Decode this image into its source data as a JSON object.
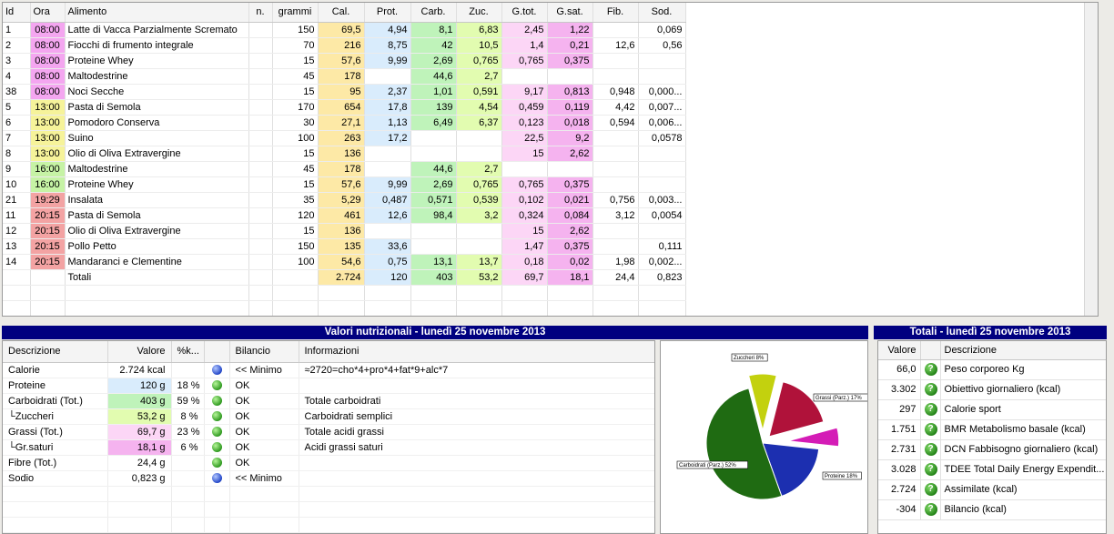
{
  "colors": {
    "ora_morning": "#f4a6f0",
    "ora_midday": "#f6f39a",
    "ora_snack": "#c6f3a5",
    "ora_evening": "#f3a3a3",
    "cal": "#fde9a6",
    "prot": "#d9ecfc",
    "carb": "#bff3ba",
    "zuc": "#e2fcb0",
    "gtot": "#fcd6f6",
    "gsat": "#f5b3ef",
    "title_bar": "#000080"
  },
  "food_table": {
    "headers": [
      "Id",
      "Ora",
      "Alimento",
      "n.",
      "grammi",
      "Cal.",
      "Prot.",
      "Carb.",
      "Zuc.",
      "G.tot.",
      "G.sat.",
      "Fib.",
      "Sod."
    ],
    "rows": [
      {
        "id": "1",
        "ora": "08:00",
        "oraclass": "morning",
        "alimento": "Latte di Vacca Parzialmente Scremato",
        "n": "",
        "grammi": "150",
        "cal": "69,5",
        "prot": "4,94",
        "carb": "8,1",
        "zuc": "6,83",
        "gtot": "2,45",
        "gsat": "1,22",
        "fib": "",
        "sod": "0,069"
      },
      {
        "id": "2",
        "ora": "08:00",
        "oraclass": "morning",
        "alimento": "Fiocchi di frumento integrale",
        "n": "",
        "grammi": "70",
        "cal": "216",
        "prot": "8,75",
        "carb": "42",
        "zuc": "10,5",
        "gtot": "1,4",
        "gsat": "0,21",
        "fib": "12,6",
        "sod": "0,56"
      },
      {
        "id": "3",
        "ora": "08:00",
        "oraclass": "morning",
        "alimento": "Proteine Whey",
        "n": "",
        "grammi": "15",
        "cal": "57,6",
        "prot": "9,99",
        "carb": "2,69",
        "zuc": "0,765",
        "gtot": "0,765",
        "gsat": "0,375",
        "fib": "",
        "sod": ""
      },
      {
        "id": "4",
        "ora": "08:00",
        "oraclass": "morning",
        "alimento": "Maltodestrine",
        "n": "",
        "grammi": "45",
        "cal": "178",
        "prot": "",
        "carb": "44,6",
        "zuc": "2,7",
        "gtot": "",
        "gsat": "",
        "fib": "",
        "sod": ""
      },
      {
        "id": "38",
        "ora": "08:00",
        "oraclass": "morning",
        "alimento": "Noci Secche",
        "n": "",
        "grammi": "15",
        "cal": "95",
        "prot": "2,37",
        "carb": "1,01",
        "zuc": "0,591",
        "gtot": "9,17",
        "gsat": "0,813",
        "fib": "0,948",
        "sod": "0,000..."
      },
      {
        "id": "5",
        "ora": "13:00",
        "oraclass": "midday",
        "alimento": "Pasta di Semola",
        "n": "",
        "grammi": "170",
        "cal": "654",
        "prot": "17,8",
        "carb": "139",
        "zuc": "4,54",
        "gtot": "0,459",
        "gsat": "0,119",
        "fib": "4,42",
        "sod": "0,007..."
      },
      {
        "id": "6",
        "ora": "13:00",
        "oraclass": "midday",
        "alimento": "Pomodoro Conserva",
        "n": "",
        "grammi": "30",
        "cal": "27,1",
        "prot": "1,13",
        "carb": "6,49",
        "zuc": "6,37",
        "gtot": "0,123",
        "gsat": "0,018",
        "fib": "0,594",
        "sod": "0,006..."
      },
      {
        "id": "7",
        "ora": "13:00",
        "oraclass": "midday",
        "alimento": "Suino",
        "n": "",
        "grammi": "100",
        "cal": "263",
        "prot": "17,2",
        "carb": "",
        "zuc": "",
        "gtot": "22,5",
        "gsat": "9,2",
        "fib": "",
        "sod": "0,0578"
      },
      {
        "id": "8",
        "ora": "13:00",
        "oraclass": "midday",
        "alimento": "Olio di Oliva Extravergine",
        "n": "",
        "grammi": "15",
        "cal": "136",
        "prot": "",
        "carb": "",
        "zuc": "",
        "gtot": "15",
        "gsat": "2,62",
        "fib": "",
        "sod": ""
      },
      {
        "id": "9",
        "ora": "16:00",
        "oraclass": "snack",
        "alimento": "Maltodestrine",
        "n": "",
        "grammi": "45",
        "cal": "178",
        "prot": "",
        "carb": "44,6",
        "zuc": "2,7",
        "gtot": "",
        "gsat": "",
        "fib": "",
        "sod": ""
      },
      {
        "id": "10",
        "ora": "16:00",
        "oraclass": "snack",
        "alimento": "Proteine Whey",
        "n": "",
        "grammi": "15",
        "cal": "57,6",
        "prot": "9,99",
        "carb": "2,69",
        "zuc": "0,765",
        "gtot": "0,765",
        "gsat": "0,375",
        "fib": "",
        "sod": ""
      },
      {
        "id": "21",
        "ora": "19:29",
        "oraclass": "evening",
        "alimento": "Insalata",
        "n": "",
        "grammi": "35",
        "cal": "5,29",
        "prot": "0,487",
        "carb": "0,571",
        "zuc": "0,539",
        "gtot": "0,102",
        "gsat": "0,021",
        "fib": "0,756",
        "sod": "0,003..."
      },
      {
        "id": "11",
        "ora": "20:15",
        "oraclass": "evening",
        "alimento": "Pasta di Semola",
        "n": "",
        "grammi": "120",
        "cal": "461",
        "prot": "12,6",
        "carb": "98,4",
        "zuc": "3,2",
        "gtot": "0,324",
        "gsat": "0,084",
        "fib": "3,12",
        "sod": "0,0054"
      },
      {
        "id": "12",
        "ora": "20:15",
        "oraclass": "evening",
        "alimento": "Olio di Oliva Extravergine",
        "n": "",
        "grammi": "15",
        "cal": "136",
        "prot": "",
        "carb": "",
        "zuc": "",
        "gtot": "15",
        "gsat": "2,62",
        "fib": "",
        "sod": ""
      },
      {
        "id": "13",
        "ora": "20:15",
        "oraclass": "evening",
        "alimento": "Pollo Petto",
        "n": "",
        "grammi": "150",
        "cal": "135",
        "prot": "33,6",
        "carb": "",
        "zuc": "",
        "gtot": "1,47",
        "gsat": "0,375",
        "fib": "",
        "sod": "0,111"
      },
      {
        "id": "14",
        "ora": "20:15",
        "oraclass": "evening",
        "alimento": "Mandaranci e Clementine",
        "n": "",
        "grammi": "100",
        "cal": "54,6",
        "prot": "0,75",
        "carb": "13,1",
        "zuc": "13,7",
        "gtot": "0,18",
        "gsat": "0,02",
        "fib": "1,98",
        "sod": "0,002..."
      }
    ],
    "totals": {
      "label": "Totali",
      "cal": "2.724",
      "prot": "120",
      "carb": "403",
      "zuc": "53,2",
      "gtot": "69,7",
      "gsat": "18,1",
      "fib": "24,4",
      "sod": "0,823"
    }
  },
  "nutri_panel": {
    "title": "Valori nutrizionali - lunedì 25 novembre 2013",
    "headers": [
      "Descrizione",
      "Valore",
      "%k...",
      "",
      "Bilancio",
      "Informazioni"
    ],
    "rows": [
      {
        "desc": "Calorie",
        "valore": "2.724 kcal",
        "pct": "",
        "status": "blue",
        "bilancio": "<< Minimo",
        "info": "≈2720=cho*4+pro*4+fat*9+alc*7",
        "bg": ""
      },
      {
        "desc": "Proteine",
        "valore": "120 g",
        "pct": "18 %",
        "status": "green",
        "bilancio": "OK",
        "info": "",
        "bg": "#d9ecfc"
      },
      {
        "desc": "Carboidrati (Tot.)",
        "valore": "403 g",
        "pct": "59 %",
        "status": "green",
        "bilancio": "OK",
        "info": "Totale carboidrati",
        "bg": "#bff3ba"
      },
      {
        "desc": "└Zuccheri",
        "valore": "53,2 g",
        "pct": "8 %",
        "status": "green",
        "bilancio": "OK",
        "info": "Carboidrati semplici",
        "bg": "#e2fcb0"
      },
      {
        "desc": "Grassi (Tot.)",
        "valore": "69,7 g",
        "pct": "23 %",
        "status": "green",
        "bilancio": "OK",
        "info": "Totale acidi grassi",
        "bg": "#fcd6f6"
      },
      {
        "desc": "└Gr.saturi",
        "valore": "18,1 g",
        "pct": "6 %",
        "status": "green",
        "bilancio": "OK",
        "info": "Acidi grassi saturi",
        "bg": "#f5b3ef"
      },
      {
        "desc": "Fibre (Tot.)",
        "valore": "24,4 g",
        "pct": "",
        "status": "green",
        "bilancio": "OK",
        "info": "",
        "bg": ""
      },
      {
        "desc": "Sodio",
        "valore": "0,823 g",
        "pct": "",
        "status": "blue",
        "bilancio": "<< Minimo",
        "info": "",
        "bg": ""
      }
    ]
  },
  "chart_data": {
    "type": "pie",
    "slices": [
      {
        "label": "Zuccheri 8%",
        "value": 8,
        "color": "#c3d10e"
      },
      {
        "label": "Grassi (Parz.) 17%",
        "value": 17,
        "color": "#b0123a"
      },
      {
        "label": "",
        "value": 6,
        "color": "#d41cb6"
      },
      {
        "label": "Proteine 18%",
        "value": 18,
        "color": "#1c2fb0"
      },
      {
        "label": "Carboidrati (Parz.) 52%",
        "value": 52,
        "color": "#1f6b12"
      }
    ]
  },
  "totals_panel": {
    "title": "Totali - lunedì 25 novembre 2013",
    "headers": [
      "Valore",
      "Descrizione"
    ],
    "rows": [
      {
        "valore": "66,0",
        "desc": "Peso corporeo Kg"
      },
      {
        "valore": "3.302",
        "desc": "Obiettivo giornaliero (kcal)"
      },
      {
        "valore": "297",
        "desc": "Calorie sport"
      },
      {
        "valore": "1.751",
        "desc": "BMR Metabolismo basale (kcal)"
      },
      {
        "valore": "2.731",
        "desc": "DCN Fabbisogno giornaliero (kcal)"
      },
      {
        "valore": "3.028",
        "desc": "TDEE Total Daily Energy Expendit..."
      },
      {
        "valore": "2.724",
        "desc": "Assimilate (kcal)"
      },
      {
        "valore": "-304",
        "desc": "Bilancio (kcal)"
      }
    ]
  }
}
